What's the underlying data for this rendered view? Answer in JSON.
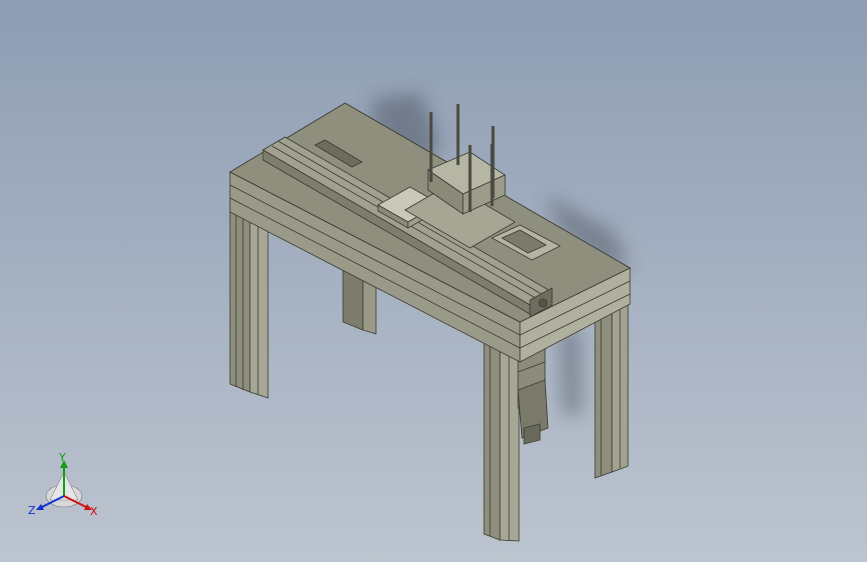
{
  "viewport": {
    "background_top": "#8e9db3",
    "background_bottom": "#bcc4cf",
    "model_color": "#8f8f7e"
  },
  "triad": {
    "x_label": "X",
    "y_label": "Y",
    "z_label": "Z",
    "x_color": "#d01010",
    "y_color": "#10a010",
    "z_color": "#1030d0"
  }
}
